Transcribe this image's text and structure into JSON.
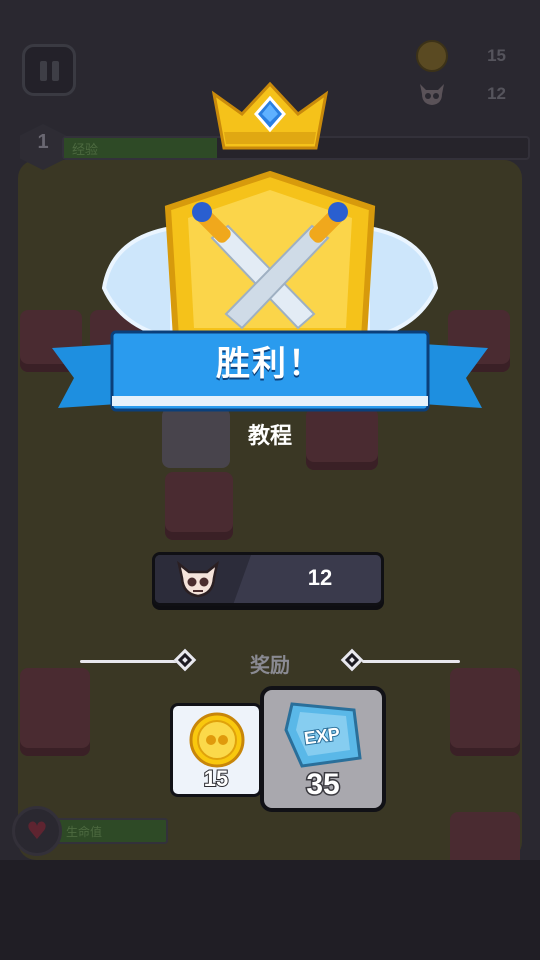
{
  "hud": {
    "coins": "15",
    "kills": "12",
    "level": "1",
    "xp_label": "经验",
    "xp_progress": 0.33,
    "hp_label": "生命值"
  },
  "result": {
    "title": "胜利！",
    "subtitle": "教程",
    "kill_count": "12",
    "rewards_title": "奖励",
    "rewards": [
      {
        "type": "coin",
        "amount": "15"
      },
      {
        "type": "exp",
        "label": "EXP",
        "amount": "35"
      }
    ]
  },
  "colors": {
    "ribbon": "#1e8fe0",
    "gold": "#f5c21a",
    "coin": "#f9c80e",
    "exp_gem": "#5ab8e8",
    "panel": "#3a3a4c"
  },
  "icons": [
    "pause-icon",
    "coin-icon",
    "skull-icon",
    "crown-icon",
    "crossed-swords-icon",
    "heart-icon",
    "exp-gem-icon"
  ]
}
